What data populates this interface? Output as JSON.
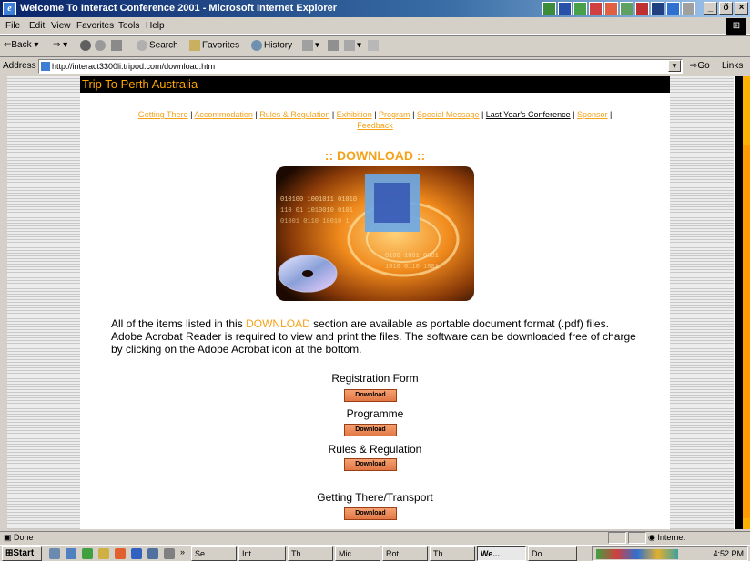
{
  "window": {
    "title": "Welcome To Interact Conference 2001 - Microsoft Internet Explorer",
    "controls": [
      "_",
      "ő",
      "×"
    ]
  },
  "menu": [
    "File",
    "Edit",
    "View",
    "Favorites",
    "Tools",
    "Help"
  ],
  "toolbar": {
    "back": "Back",
    "search": "Search",
    "favorites": "Favorites",
    "history": "History"
  },
  "address": {
    "label": "Address",
    "url": "http://interact3300li.tripod.com/download.htm",
    "go": "Go",
    "links": "Links"
  },
  "page": {
    "banner": "Trip To Perth Australia",
    "nav": [
      "Getting There",
      "Accommodation",
      "Rules & Regulation",
      "Exhibition",
      "Program",
      "Special Message",
      "Last Year's Conference",
      "Sponsor",
      "Feedback"
    ],
    "download_title": ":: DOWNLOAD ::",
    "intro_before": "All of the items listed in this ",
    "intro_highlight": "DOWNLOAD",
    "intro_after": " section are available as portable document format (.pdf) files. Adobe Acrobat Reader is required to view and print the files. The software can be downloaded free of charge by clicking on the Adobe Acrobat icon at the bottom.",
    "downloads": [
      {
        "label": "Registration Form",
        "button": "Download"
      },
      {
        "label": "Programme",
        "button": "Download"
      },
      {
        "label": "Rules & Regulation",
        "button": "Download"
      },
      {
        "label": "Getting There/Transport",
        "button": "Download"
      }
    ],
    "hero_icon": "cd-disc-image"
  },
  "status": {
    "text": "Done",
    "zone": "Internet"
  },
  "taskbar": {
    "start": "Start",
    "tasks": [
      "Se...",
      "Int...",
      "Th...",
      "Mic...",
      "Rot...",
      "Th...",
      "We...",
      "Do..."
    ],
    "clock": "4:52 PM",
    "overflow": "»"
  },
  "colors": {
    "accent": "#f4a21a",
    "banner_bg": "#000000",
    "title_bar": "#0a246a"
  }
}
